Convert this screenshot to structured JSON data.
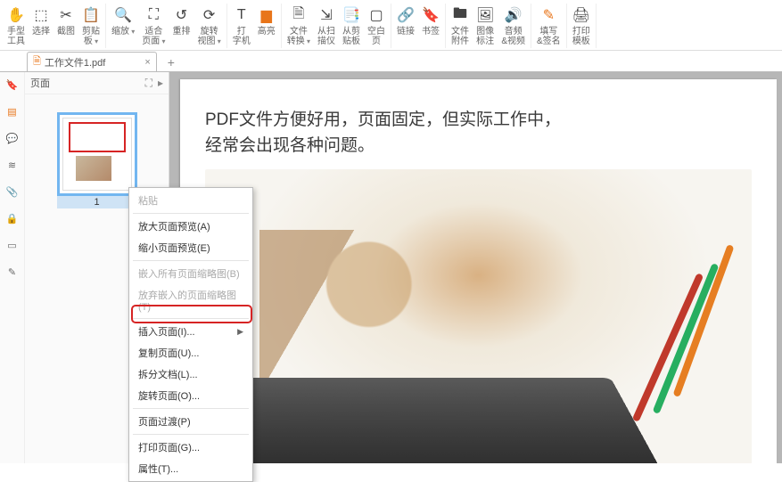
{
  "toolbar": [
    {
      "icon": "✋",
      "label": "手型\n工具",
      "orange": true
    },
    {
      "icon": "⬚",
      "label": "选择"
    },
    {
      "icon": "✂",
      "label": "截图"
    },
    {
      "icon": "📋",
      "label": "剪贴\n板",
      "drop": true
    },
    {
      "icon": "🔍",
      "label": "缩放",
      "drop": true
    },
    {
      "icon": "⛶",
      "label": "适合\n页面",
      "drop": true
    },
    {
      "icon": "↺",
      "label": "重排"
    },
    {
      "icon": "⟳",
      "label": "旋转\n视图",
      "drop": true
    },
    {
      "icon": "T",
      "label": "打\n字机"
    },
    {
      "icon": "▆",
      "label": "高亮",
      "orange": true
    },
    {
      "icon": "🗎",
      "label": "文件\n转换",
      "drop": true
    },
    {
      "icon": "⇲",
      "label": "从扫\n描仪"
    },
    {
      "icon": "📑",
      "label": "从剪\n贴板"
    },
    {
      "icon": "▢",
      "label": "空白\n页"
    },
    {
      "icon": "🔗",
      "label": "链接"
    },
    {
      "icon": "🔖",
      "label": "书签"
    },
    {
      "icon": "🖿",
      "label": "文件\n附件"
    },
    {
      "icon": "🖼",
      "label": "图像\n标注"
    },
    {
      "icon": "🔊",
      "label": "音频\n&视频"
    },
    {
      "icon": "✎",
      "label": "填写\n&签名",
      "orange": true
    },
    {
      "icon": "🖨",
      "label": "打印\n模板"
    }
  ],
  "tab": {
    "name": "工作文件1.pdf"
  },
  "panel": {
    "title": "页面",
    "thumb_num": "1"
  },
  "doc": {
    "line1": "PDF文件方便好用，页面固定，但实际工作中，",
    "line2": "经常会出现各种问题。"
  },
  "ctx": {
    "paste": "粘贴",
    "zoom_in": "放大页面预览(A)",
    "zoom_out": "缩小页面预览(E)",
    "embed_all": "嵌入所有页面缩略图(B)",
    "discard": "放弃嵌入的页面缩略图(T)",
    "insert": "插入页面(I)...",
    "copy": "复制页面(U)...",
    "split": "拆分文档(L)...",
    "rotate": "旋转页面(O)...",
    "filter": "页面过渡(P)",
    "print": "打印页面(G)...",
    "prop": "属性(T)..."
  }
}
